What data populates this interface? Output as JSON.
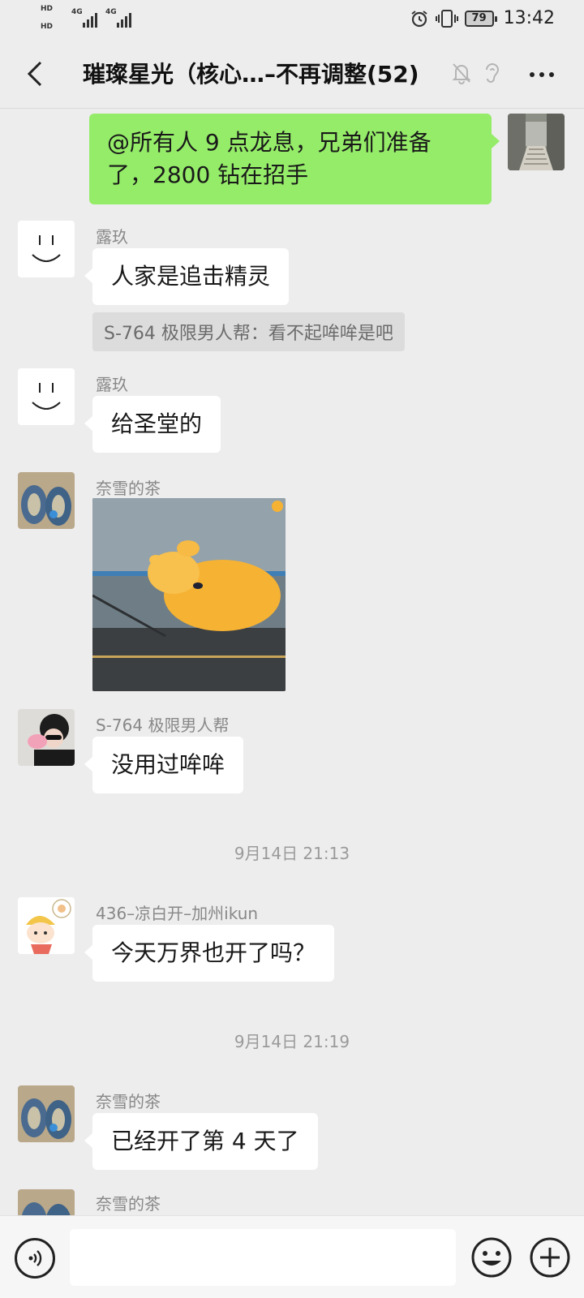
{
  "status_bar": {
    "hd1": "HD",
    "hd2": "HD",
    "net1": "4G",
    "net2": "4G",
    "battery": "79",
    "time": "13:42"
  },
  "header": {
    "title": "璀璨星光（核心…–不再调整(52)"
  },
  "messages": {
    "m1": {
      "text": "@所有人  9 点龙息，兄弟们准备了，2800 钻在招手"
    },
    "m2": {
      "sender": "露玖",
      "text": "人家是追击精灵",
      "quote": "S-764  极限男人帮：看不起哞哞是吧"
    },
    "m3": {
      "sender": "露玖",
      "text": "给圣堂的"
    },
    "m4": {
      "sender": "奈雪的茶"
    },
    "m5": {
      "sender": "S-764  极限男人帮",
      "text": "没用过哞哞"
    },
    "t1": "9月14日 21:13",
    "m6": {
      "sender": "436–凉白开–加州ikun",
      "text": "今天万界也开了吗？"
    },
    "t2": "9月14日 21:19",
    "m7": {
      "sender": "奈雪的茶",
      "text": "已经开了第 4 天了"
    },
    "m8": {
      "sender": "奈雪的茶"
    }
  },
  "input": {
    "value": "",
    "placeholder": ""
  },
  "colors": {
    "background": "#ededed",
    "self_bubble": "#95ec69",
    "other_bubble": "#ffffff"
  }
}
